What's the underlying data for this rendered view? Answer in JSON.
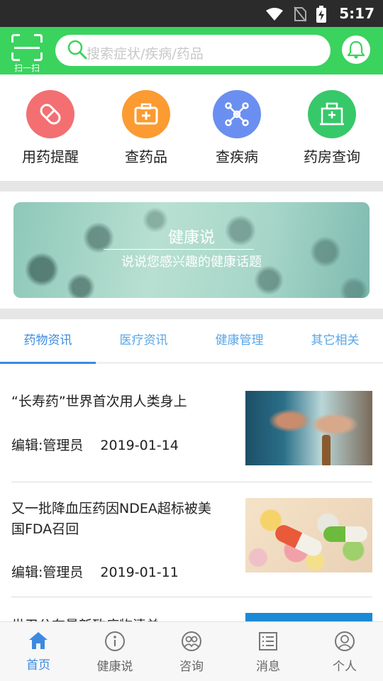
{
  "status_bar": {
    "time": "5:17",
    "icons": [
      "wifi-icon",
      "no-sim-icon",
      "battery-charging-icon"
    ]
  },
  "header": {
    "scan_label": "扫一扫",
    "search_placeholder": "搜索症状/疾病/药品",
    "icons": [
      "scan-icon",
      "search-icon",
      "bell-icon"
    ],
    "accent": "#3ad35e"
  },
  "menu": [
    {
      "label": "用药提醒",
      "icon": "pill-icon",
      "color": "#f36f72"
    },
    {
      "label": "查药品",
      "icon": "medicine-box-icon",
      "color": "#fb9b31"
    },
    {
      "label": "查疾病",
      "icon": "molecule-icon",
      "color": "#6a8ff0"
    },
    {
      "label": "药房查询",
      "icon": "pharmacy-icon",
      "color": "#37c86a"
    }
  ],
  "banner": {
    "title": "健康说",
    "subtitle": "说说您感兴趣的健康话题"
  },
  "tabs": [
    {
      "label": "药物资讯",
      "active": true
    },
    {
      "label": "医疗资讯",
      "active": false
    },
    {
      "label": "健康管理",
      "active": false
    },
    {
      "label": "其它相关",
      "active": false
    }
  ],
  "news": [
    {
      "title": "“长寿药”世界首次用人类身上",
      "editor": "编辑:管理员",
      "date": "2019-01-14"
    },
    {
      "title": "又一批降血压药因NDEA超标被美国FDA召回",
      "editor": "编辑:管理员",
      "date": "2019-01-11"
    },
    {
      "title": "世卫公布最新致癌物清单",
      "editor": "",
      "date": ""
    }
  ],
  "bottom_nav": [
    {
      "label": "首页",
      "icon": "home-icon",
      "active": true
    },
    {
      "label": "健康说",
      "icon": "info-icon",
      "active": false
    },
    {
      "label": "咨询",
      "icon": "consult-icon",
      "active": false
    },
    {
      "label": "消息",
      "icon": "message-list-icon",
      "active": false
    },
    {
      "label": "个人",
      "icon": "person-icon",
      "active": false
    }
  ],
  "colors": {
    "tab_active": "#3b8ae0",
    "nav_active": "#3b8ae0"
  }
}
